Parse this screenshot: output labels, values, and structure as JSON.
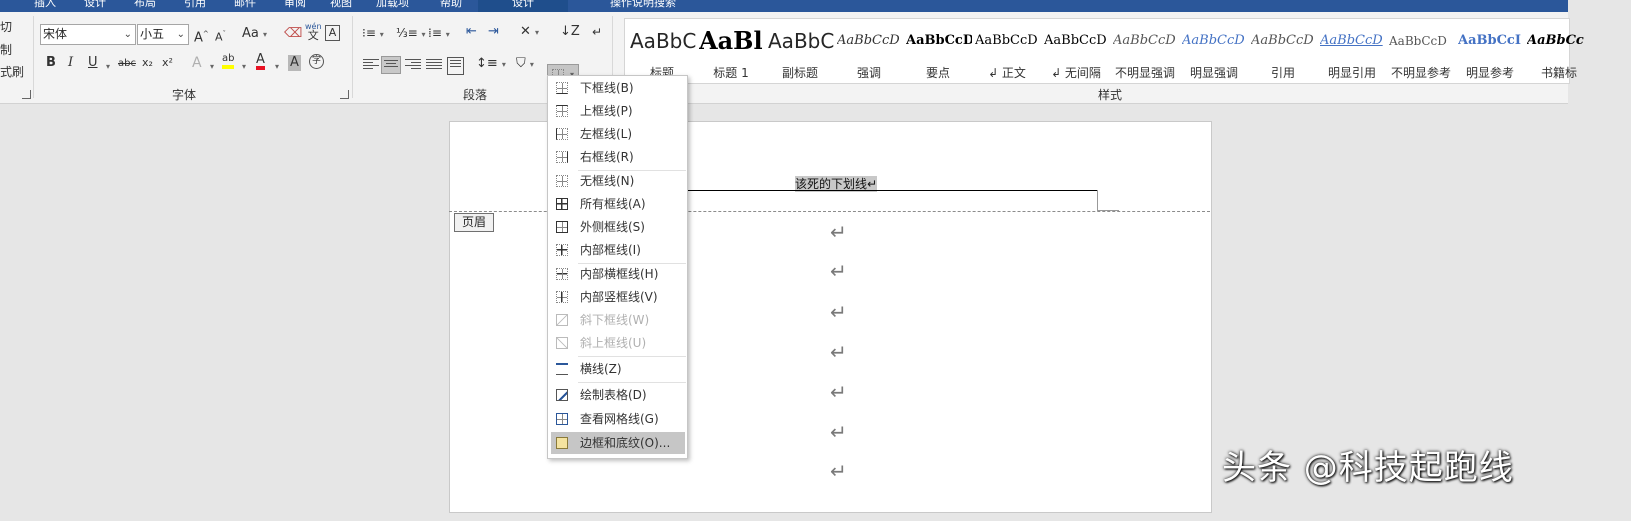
{
  "ribbon_tabs": [
    "插入",
    "设计",
    "布局",
    "引用",
    "邮件",
    "审阅",
    "视图",
    "加载项",
    "帮助",
    "设计",
    "操作说明搜索"
  ],
  "clipboard": {
    "cut": "切",
    "copy": "制",
    "format_painter": "式刷"
  },
  "font": {
    "name": "宋体",
    "size": "小五",
    "group_label": "字体",
    "case_label": "Aa",
    "pinyin_label": "wén",
    "pinyin_char": "文",
    "border_char": "A",
    "bold": "B",
    "italic": "I",
    "underline": "U",
    "strike": "abc",
    "subscript": "x₂",
    "superscript": "x²",
    "grow": "A",
    "shrink": "A",
    "effects": "A",
    "highlight": "ab",
    "color": "A",
    "shade": "A",
    "circle": "字"
  },
  "paragraph": {
    "group_label": "段落"
  },
  "styles": {
    "group_label": "样式",
    "items": [
      {
        "preview": "AaBbC",
        "name": "标题"
      },
      {
        "preview": "AaBl",
        "name": "标题 1"
      },
      {
        "preview": "AaBbC",
        "name": "副标题"
      },
      {
        "preview": "AaBbCcD",
        "name": "强调"
      },
      {
        "preview": "AaBbCcD",
        "name": "要点"
      },
      {
        "preview": "AaBbCcD",
        "name": "↲ 正文"
      },
      {
        "preview": "AaBbCcD",
        "name": "↲ 无间隔"
      },
      {
        "preview": "AaBbCcD",
        "name": "不明显强调"
      },
      {
        "preview": "AaBbCcD",
        "name": "明显强调"
      },
      {
        "preview": "AaBbCcD",
        "name": "引用"
      },
      {
        "preview": "AaBbCcD",
        "name": "明显引用"
      },
      {
        "preview": "AaBbCcD",
        "name": "不明显参考"
      },
      {
        "preview": "AaBbCcI",
        "name": "明显参考"
      },
      {
        "preview": "AaBbCc",
        "name": "书籍标"
      }
    ]
  },
  "document": {
    "header_tag": "页眉",
    "header_text": "该死的下划线↵",
    "para_mark": "↵"
  },
  "borders_menu": {
    "items": [
      {
        "label": "下框线(B)",
        "disabled": false
      },
      {
        "label": "上框线(P)",
        "disabled": false
      },
      {
        "label": "左框线(L)",
        "disabled": false
      },
      {
        "label": "右框线(R)",
        "disabled": false
      },
      {
        "label": "无框线(N)",
        "disabled": false
      },
      {
        "label": "所有框线(A)",
        "disabled": false
      },
      {
        "label": "外侧框线(S)",
        "disabled": false
      },
      {
        "label": "内部框线(I)",
        "disabled": false
      },
      {
        "label": "内部横框线(H)",
        "disabled": false
      },
      {
        "label": "内部竖框线(V)",
        "disabled": false
      },
      {
        "label": "斜下框线(W)",
        "disabled": true
      },
      {
        "label": "斜上框线(U)",
        "disabled": true
      },
      {
        "label": "横线(Z)",
        "disabled": false
      },
      {
        "label": "绘制表格(D)",
        "disabled": false
      },
      {
        "label": "查看网格线(G)",
        "disabled": false
      },
      {
        "label": "边框和底纹(O)...",
        "disabled": false,
        "highlighted": true
      }
    ]
  },
  "watermark": "头条 @科技起跑线",
  "colors": {
    "accent": "#2b579a",
    "font_color": "#e81123",
    "highlight": "#ffff00"
  }
}
